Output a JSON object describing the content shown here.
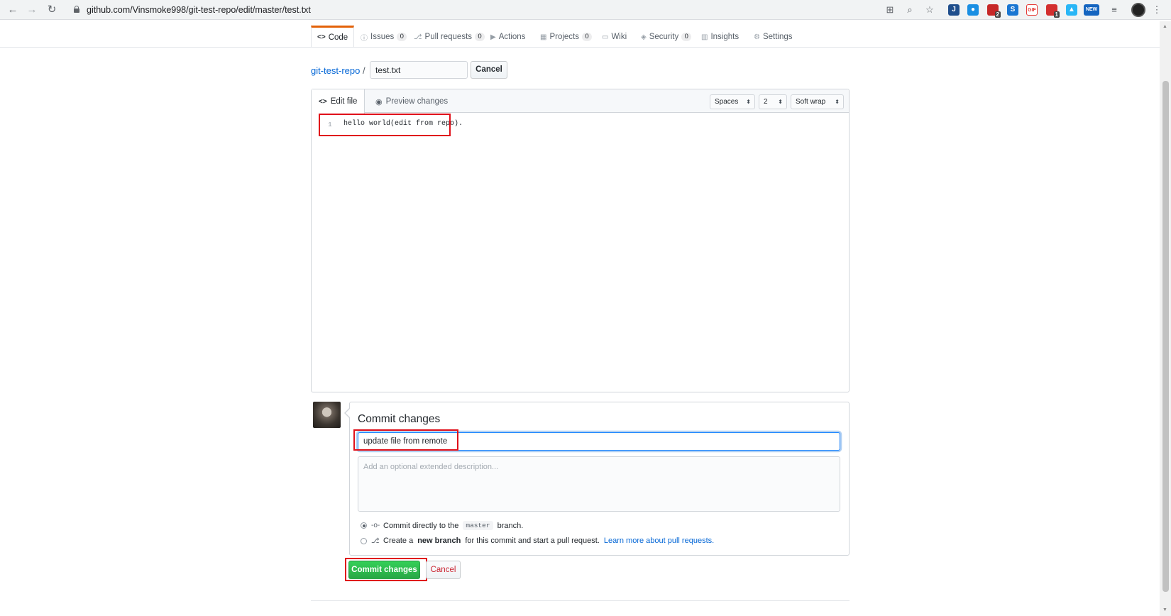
{
  "browser": {
    "url": "github.com/Vinsmoke998/git-test-repo/edit/master/test.txt",
    "ext_new_label": "NEW",
    "ext_badges": [
      "2",
      "1"
    ]
  },
  "repo_nav": {
    "tabs": [
      {
        "label": "Code",
        "icon": "<>"
      },
      {
        "label": "Issues",
        "count": "0",
        "icon": "ⓘ"
      },
      {
        "label": "Pull requests",
        "count": "0",
        "icon": "⎇"
      },
      {
        "label": "Actions",
        "icon": "▶"
      },
      {
        "label": "Projects",
        "count": "0",
        "icon": "▦"
      },
      {
        "label": "Wiki",
        "icon": "▭"
      },
      {
        "label": "Security",
        "count": "0",
        "icon": "◈"
      },
      {
        "label": "Insights",
        "icon": "▥"
      },
      {
        "label": "Settings",
        "icon": "⚙"
      }
    ]
  },
  "breadcrumb": {
    "repo": "git-test-repo",
    "separator": "/",
    "filename": "test.txt",
    "cancel": "Cancel"
  },
  "editor": {
    "tab_edit": "Edit file",
    "tab_preview": "Preview changes",
    "indent_mode": "Spaces",
    "indent_size": "2",
    "wrap_mode": "Soft wrap",
    "lines": [
      {
        "num": "1",
        "text": "hello world(edit from repo)."
      }
    ]
  },
  "commit": {
    "title": "Commit changes",
    "summary_value": "update file from remote",
    "description_placeholder": "Add an optional extended description...",
    "option_direct_prefix": "Commit directly to the",
    "option_direct_branch": "master",
    "option_direct_suffix": "branch.",
    "option_new_prefix": "Create a",
    "option_new_bold": "new branch",
    "option_new_suffix": "for this commit and start a pull request.",
    "option_new_link": "Learn more about pull requests.",
    "commit_button": "Commit changes",
    "cancel_button": "Cancel"
  },
  "colors": {
    "accent_tab": "#e36209",
    "link": "#0366d6",
    "primary_button": "#28a745",
    "highlight": "#e0101a"
  }
}
